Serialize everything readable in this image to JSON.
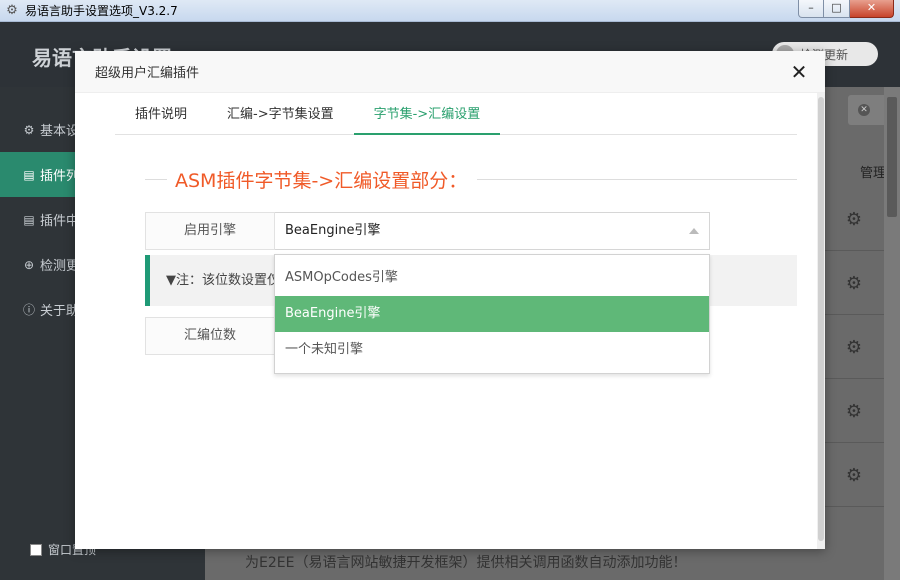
{
  "window": {
    "title": "易语言助手设置选项_V3.2.7",
    "min_label": "–",
    "max_label": "□",
    "close_label": "✕"
  },
  "app": {
    "header_title": "易语言助手设置",
    "check_update_label": "检测更新",
    "sidebar": {
      "items": [
        {
          "icon": "gear-icon",
          "glyph": "⚙",
          "label": "基本设置"
        },
        {
          "icon": "clipboard-icon",
          "glyph": "▤",
          "label": "插件列表"
        },
        {
          "icon": "clipboard-icon",
          "glyph": "▤",
          "label": "插件中心"
        },
        {
          "icon": "download-icon",
          "glyph": "⊕",
          "label": "检测更新"
        },
        {
          "icon": "info-icon",
          "glyph": "ⓘ",
          "label": "关于助手"
        }
      ],
      "window_checkbox_label": "窗口置顶"
    },
    "main": {
      "column_header": "管理",
      "footer_text": "为E2EE（易语言网站敏捷开发框架）提供相关调用函数自动添加功能！"
    }
  },
  "modal": {
    "title": "超级用户汇编插件",
    "close_label": "✕",
    "tabs": [
      {
        "label": "插件说明",
        "active": false
      },
      {
        "label": "汇编->字节集设置",
        "active": false
      },
      {
        "label": "字节集->汇编设置",
        "active": true
      }
    ],
    "section_title": "ASM插件字节集->汇编设置部分：",
    "engine_field": {
      "label": "启用引擎",
      "value": "BeaEngine引擎"
    },
    "note_text": "▼注：该位数设置仅",
    "bits_field": {
      "label": "汇编位数"
    },
    "dropdown": {
      "options": [
        {
          "label": "ASMOpCodes引擎",
          "selected": false
        },
        {
          "label": "BeaEngine引擎",
          "selected": true
        },
        {
          "label": "一个未知引擎",
          "selected": false
        }
      ]
    }
  },
  "colors": {
    "accent_green": "#5fb878",
    "tab_active": "#2aa06e",
    "section_title": "#f05a28",
    "sidebar_active": "#2a8a6e"
  }
}
